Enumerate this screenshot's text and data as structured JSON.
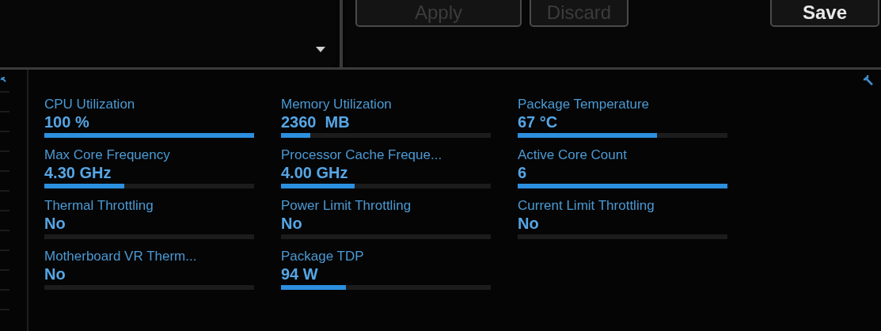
{
  "buttons": [
    {
      "label": "Apply",
      "disabled": true
    },
    {
      "label": "Discard",
      "disabled": true
    },
    {
      "label": "Save",
      "disabled": false
    }
  ],
  "metrics": [
    {
      "label": "CPU Utilization",
      "value": "100 %",
      "level": 1.0
    },
    {
      "label": "Memory Utilization",
      "value": "2360  MB",
      "level": 0.14
    },
    {
      "label": "Package Temperature",
      "value": "67 °C",
      "level": 0.665
    },
    {
      "label": "Max Core Frequency",
      "value": "4.30 GHz",
      "level": 0.38
    },
    {
      "label": "Processor Cache Freque...",
      "value": "4.00 GHz",
      "level": 0.35
    },
    {
      "label": "Active Core Count",
      "value": "6",
      "level": 1.0
    },
    {
      "label": "Thermal Throttling",
      "value": "No",
      "level": 0
    },
    {
      "label": "Power Limit Throttling",
      "value": "No",
      "level": 0
    },
    {
      "label": "Current Limit Throttling",
      "value": "No",
      "level": 0
    },
    {
      "label": "Motherboard VR Therm...",
      "value": "No",
      "level": 0
    },
    {
      "label": "Package TDP",
      "value": "94 W",
      "level": 0.31
    }
  ]
}
